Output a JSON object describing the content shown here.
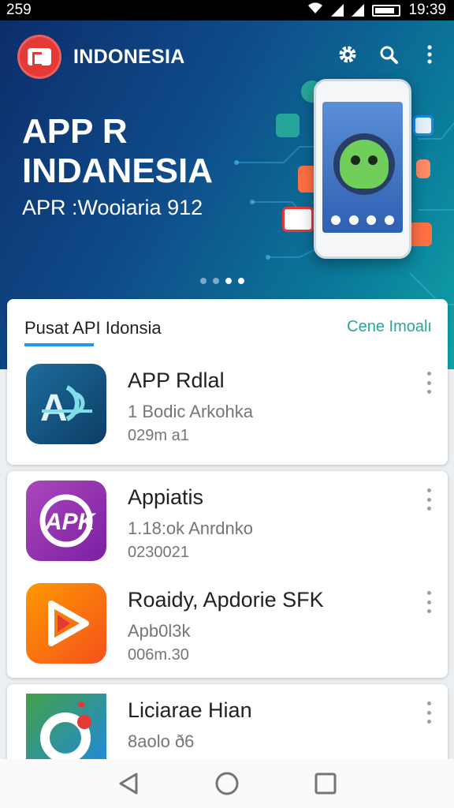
{
  "status": {
    "left": "259",
    "time": "19:39"
  },
  "header": {
    "app_name": "INDONESIA"
  },
  "hero": {
    "title_line1": "APP R",
    "title_line2": "INDANESIA",
    "subtitle": "APR :Wooiaria 912"
  },
  "section": {
    "title": "Pusat API Idonsia",
    "link": "Cene Imoalı"
  },
  "apps": [
    {
      "title": "APP Rdlal",
      "line1": "1 Bodic Arkohka",
      "line2": "029m a1",
      "icon": "ap-logo-icon",
      "color": "#1c6d9c"
    },
    {
      "title": "Appiatis",
      "line1": "1.18:ok Anrdnko",
      "line2": "0230021",
      "icon": "apk-logo-icon",
      "color": "#9c27b0"
    },
    {
      "title": "Roaidy, Apdorie SFK",
      "line1": "Apb0l3k",
      "line2": "006m.30",
      "icon": "play-logo-icon",
      "color": "#f57c00"
    },
    {
      "title": "Liciarae Hian",
      "line1": "8aolo ð6",
      "line2": "",
      "icon": "ring-logo-icon",
      "color": "#1e88e5"
    }
  ],
  "carousel": {
    "count": 4,
    "active": 3
  }
}
